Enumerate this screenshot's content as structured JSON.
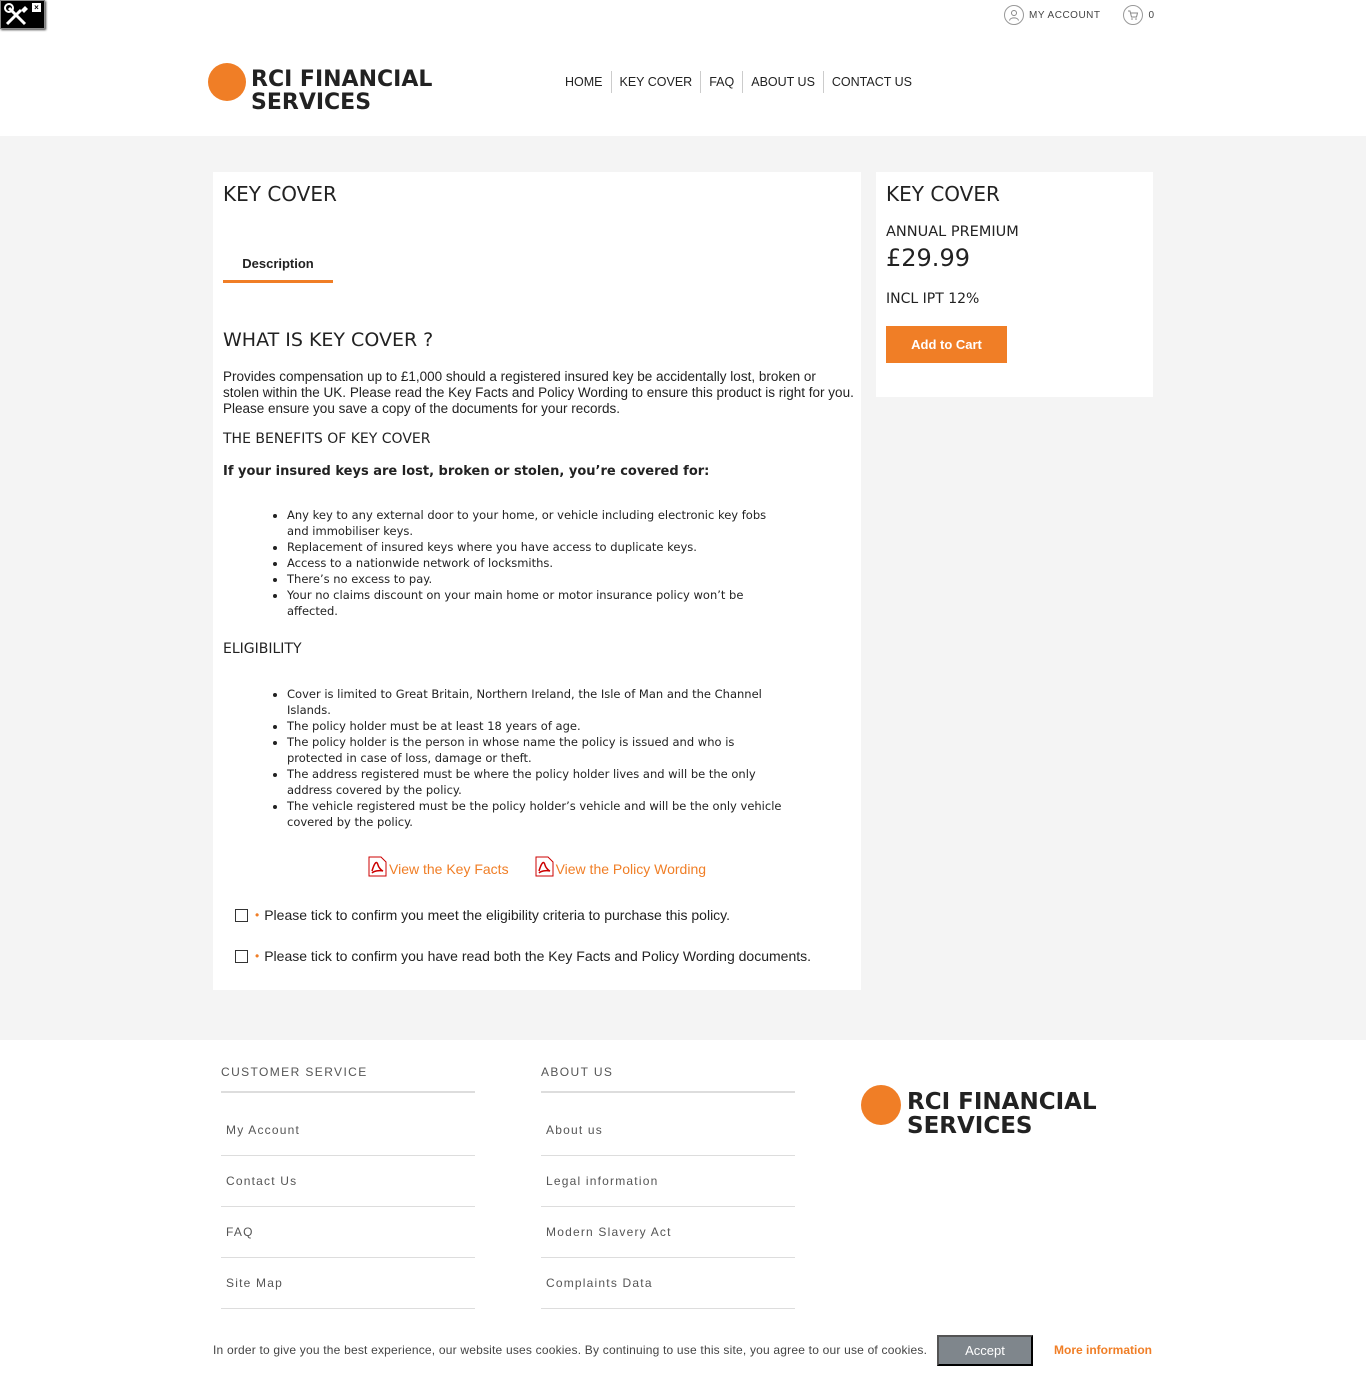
{
  "header": {
    "account_label": "MY ACCOUNT",
    "cart_count": "0",
    "logo_line1": "RCI FINANCIAL",
    "logo_line2": "SERVICES",
    "nav": [
      "HOME",
      "KEY COVER",
      "FAQ",
      "ABOUT US",
      "CONTACT US"
    ]
  },
  "product": {
    "title": "KEY COVER",
    "tab": "Description",
    "heading": "WHAT IS KEY COVER ?",
    "intro": "Provides compensation up to £1,000 should a registered insured key be accidentally lost, broken or stolen within the UK. Please read the Key Facts and Policy Wording to ensure this product is right for you. Please ensure you save a copy of the documents for your records.",
    "benefits_heading": "THE BENEFITS OF KEY COVER",
    "covered_for": "If your insured keys are lost, broken or stolen, you’re covered for:",
    "benefits": [
      "Any key to any external door to your home, or vehicle including electronic key fobs and immobiliser keys.",
      "Replacement of insured keys where you have access to duplicate keys.",
      "Access to a nationwide network of locksmiths.",
      "There’s no excess to pay.",
      "Your no claims discount on your main home or motor insurance policy won’t be affected."
    ],
    "eligibility_heading": "ELIGIBILITY",
    "eligibility": [
      "Cover is limited to Great Britain, Northern Ireland, the Isle of Man and the Channel Islands.",
      "The policy holder must be at least 18 years of age.",
      "The policy holder is the person in whose name the policy is issued and who is protected in case of loss, damage or theft.",
      "The address registered must be where the policy holder lives and will be the only address covered by the policy.",
      "The vehicle registered must be the policy holder’s vehicle and will be the only vehicle covered by the policy."
    ],
    "key_facts_link": "View the Key Facts",
    "policy_wording_link": "View the Policy Wording",
    "check_eligibility": "Please tick to confirm you meet the eligibility criteria to purchase this policy.",
    "check_documents": "Please tick to confirm you have read both the Key Facts and Policy Wording documents.",
    "required_mark": "•"
  },
  "sidebar": {
    "title": "KEY COVER",
    "premium_label": "ANNUAL PREMIUM",
    "price": "£29.99",
    "ipt": "INCL IPT 12%",
    "add_to_cart": "Add to Cart"
  },
  "footer": {
    "customer_service": {
      "heading": "CUSTOMER SERVICE",
      "links": [
        "My Account",
        "Contact Us",
        "FAQ",
        "Site Map"
      ]
    },
    "about_us": {
      "heading": "ABOUT US",
      "links": [
        "About us",
        "Legal information",
        "Modern Slavery Act",
        "Complaints Data"
      ]
    }
  },
  "cookie": {
    "message": "In order to give you the best experience, our website uses cookies. By continuing to use this site, you agree to our use of cookies.",
    "accept": "Accept",
    "more": "More information"
  },
  "colors": {
    "accent": "#f07e26",
    "band": "#f4f4f4",
    "accept_bg": "#7f868c"
  },
  "icons": [
    "tools-icon",
    "user-icon",
    "cart-icon",
    "pdf-icon"
  ]
}
